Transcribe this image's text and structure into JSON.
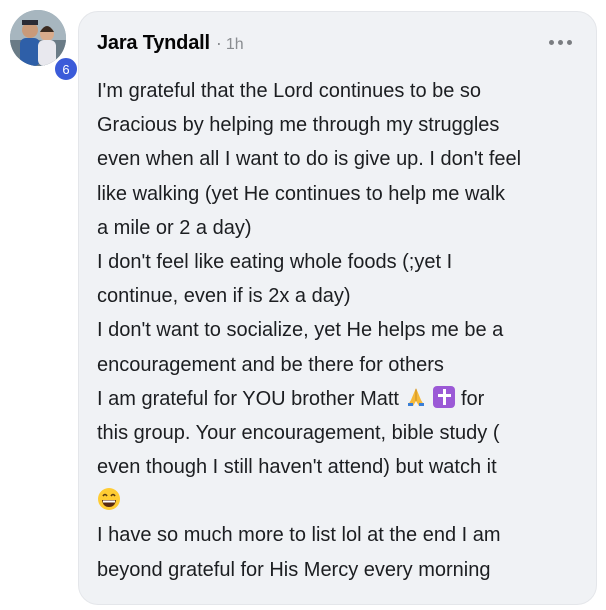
{
  "comment": {
    "author": "Jara Tyndall",
    "separator": "·",
    "time": "1h",
    "badge": "6",
    "lines": [
      "I'm grateful that the Lord continues to be so",
      "Gracious by helping me through my struggles",
      "even when all I want to do is give up. I don't feel",
      "like walking (yet He continues to help me walk",
      "a mile or 2 a day)",
      "I don't feel like eating whole foods (;yet I",
      "continue, even if is 2x a day)",
      "I don't want to socialize, yet He helps me be a",
      "encouragement and be there for others"
    ],
    "line_grateful_start": "I am grateful for YOU brother Matt",
    "line_grateful_end": "for",
    "lines_after": [
      "this group. Your encouragement, bible study (",
      "even though I still haven't attend) but watch it"
    ],
    "lines_final": [
      "I have so much more to list lol at the end I am",
      "beyond grateful for His Mercy every morning"
    ],
    "icons": [
      "praying-hands-icon",
      "latin-cross-icon",
      "grinning-face-icon",
      "more-options-icon"
    ]
  },
  "colors": {
    "bubble": "#f0f2f5",
    "badge": "#3b5bd9",
    "meta": "#8a8d91",
    "text": "#1c1e21"
  }
}
